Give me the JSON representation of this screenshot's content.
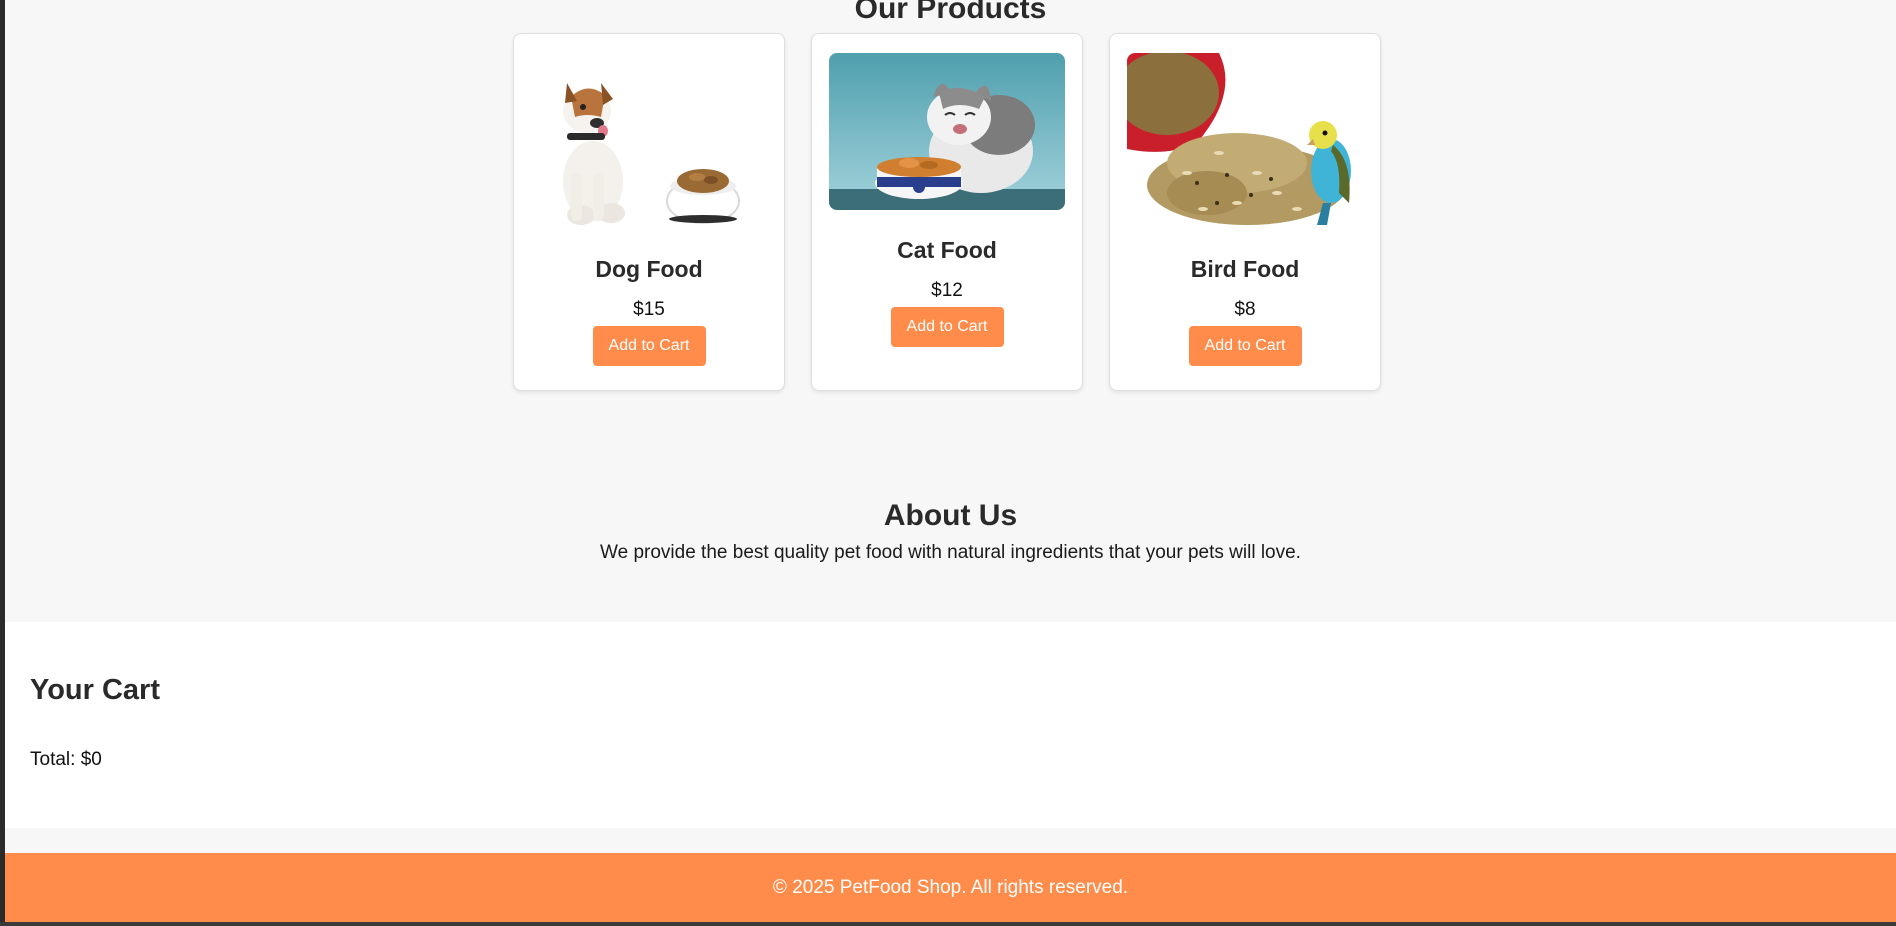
{
  "products": {
    "title": "Our Products",
    "items": [
      {
        "name": "Dog Food",
        "price": "$15",
        "button_label": "Add to Cart",
        "image": "dog-with-food-bowl"
      },
      {
        "name": "Cat Food",
        "price": "$12",
        "button_label": "Add to Cart",
        "image": "cat-with-food-bowl"
      },
      {
        "name": "Bird Food",
        "price": "$8",
        "button_label": "Add to Cart",
        "image": "parakeet-with-seed-bowl"
      }
    ]
  },
  "about": {
    "title": "About Us",
    "text": "We provide the best quality pet food with natural ingredients that your pets will love."
  },
  "cart": {
    "title": "Your Cart",
    "total": "Total: $0"
  },
  "footer": {
    "text": "© 2025 PetFood Shop. All rights reserved."
  },
  "colors": {
    "accent": "#ff8c4a",
    "page_bg": "#f7f7f7",
    "card_bg": "#ffffff",
    "text": "#2a2a2a"
  }
}
